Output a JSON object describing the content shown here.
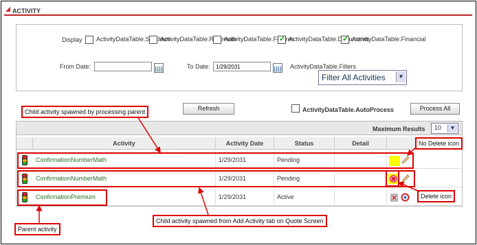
{
  "header": {
    "title": "ACTIVITY"
  },
  "filters": {
    "display_label": "Display",
    "checkboxes": [
      {
        "label": "ActivityDataTable.Shadows",
        "checked": false
      },
      {
        "label": "ActivityDataTable.Reversals",
        "checked": false
      },
      {
        "label": "ActivityDataTable.Futures",
        "checked": false
      },
      {
        "label": "ActivityDataTable.Documents",
        "checked": true
      },
      {
        "label": "ActivityDataTable.Financial",
        "checked": true
      }
    ],
    "from_date_label": "From Date:",
    "from_date_value": "",
    "to_date_label": "To Date:",
    "to_date_value": "1/29/2031",
    "filters_label": "ActivityDataTable.Filters",
    "filter_select": "Filter All Activities"
  },
  "toolbar": {
    "refresh": "Refresh",
    "autoprocess_label": "ActivityDataTable.AutoProcess",
    "process_all": "Process All"
  },
  "table": {
    "max_results_label": "Maximum Results",
    "max_results_value": "10",
    "columns": [
      "Activity",
      "Activity Date",
      "Status",
      "Detail"
    ],
    "rows": [
      {
        "activity": "ConfirmationNumberMath",
        "date": "1/29/2031",
        "status": "Pending"
      },
      {
        "activity": "ConfirmationNumberMath",
        "date": "1/29/2031",
        "status": "Pending"
      },
      {
        "activity": "ConfirmationPremium",
        "date": "1/29/2031",
        "status": "Active"
      }
    ]
  },
  "annotations": {
    "child_processing": "Child activity spawned by processing parent",
    "no_delete": "No Delete icon",
    "delete_icon": "Delete icon",
    "parent": "Parent activity",
    "child_quote": "Child activity spawned from Add Activity tab on Quote Screen"
  },
  "colors": {
    "accent": "#cc2222",
    "annotation": "#dd0000",
    "link_green": "#2a6e2a",
    "highlight": "#ffff00"
  }
}
